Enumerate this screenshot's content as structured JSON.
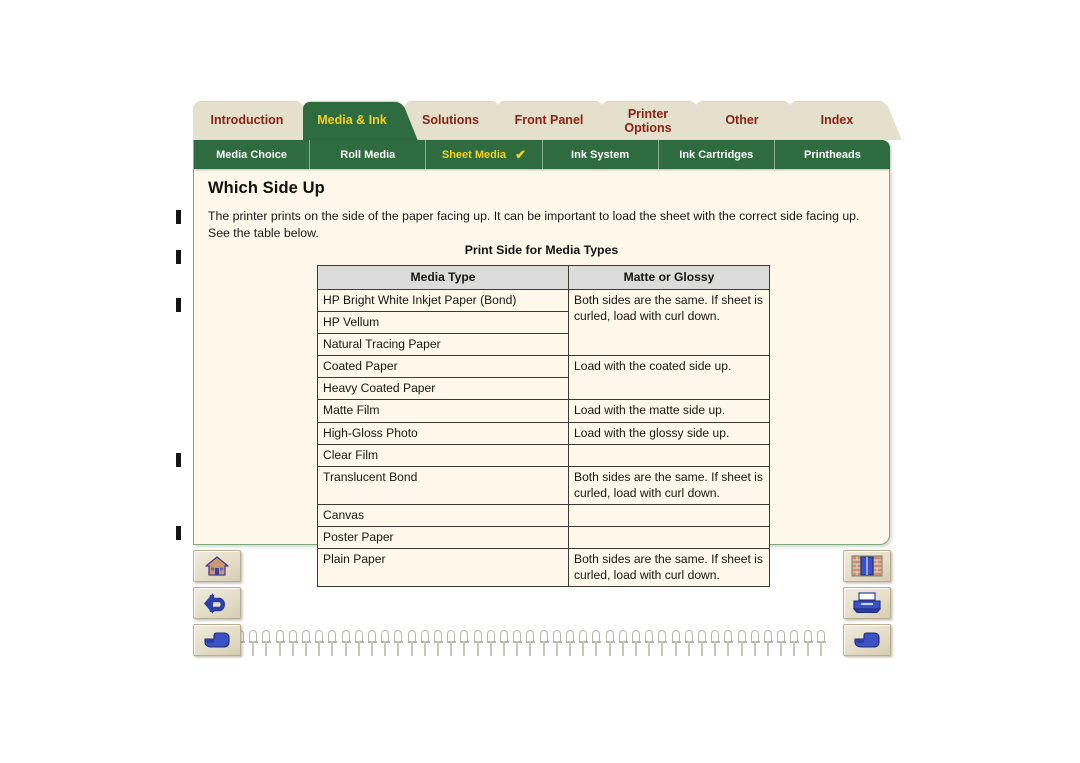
{
  "main_tabs": [
    {
      "label": "Introduction",
      "active": false
    },
    {
      "label": "Media & Ink",
      "active": true
    },
    {
      "label": "Solutions",
      "active": false
    },
    {
      "label": "Front Panel",
      "active": false
    },
    {
      "label": "Printer Options",
      "active": false,
      "line1": "Printer",
      "line2": "Options"
    },
    {
      "label": "Other",
      "active": false
    },
    {
      "label": "Index",
      "active": false
    }
  ],
  "sub_tabs": [
    {
      "label": "Media Choice",
      "active": false,
      "check": ""
    },
    {
      "label": "Roll Media",
      "active": false,
      "check": ""
    },
    {
      "label": "Sheet Media",
      "active": true,
      "check": "✔"
    },
    {
      "label": "Ink System",
      "active": false,
      "check": ""
    },
    {
      "label": "Ink Cartridges",
      "active": false,
      "check": ""
    },
    {
      "label": "Printheads",
      "active": false,
      "check": ""
    }
  ],
  "content": {
    "title": "Which Side Up",
    "intro": "The printer prints on the side of the paper facing up. It can be important to load the sheet with the correct side facing up. See the table below.",
    "table_caption": "Print Side for Media Types"
  },
  "table": {
    "headers": [
      "Media Type",
      "Matte or Glossy"
    ],
    "rows": [
      {
        "media": "HP Bright White Inkjet Paper (Bond)",
        "side": "Both sides are the same. If sheet is curled, load with curl down.",
        "side_rowspan": 3
      },
      {
        "media": "HP Vellum",
        "side": null
      },
      {
        "media": "Natural Tracing Paper",
        "side": null
      },
      {
        "media": "Coated Paper",
        "side": "Load with the coated side up.",
        "side_rowspan": 2
      },
      {
        "media": "Heavy Coated Paper",
        "side": null
      },
      {
        "media": "Matte Film",
        "side": "Load with the matte side up.",
        "side_rowspan": 1
      },
      {
        "media": "High-Gloss Photo",
        "side": "Load with the glossy side up.",
        "side_rowspan": 1
      },
      {
        "media": "Clear Film",
        "side": "",
        "side_rowspan": 1
      },
      {
        "media": "Translucent Bond",
        "side": "Both sides are the same. If sheet is curled, load with curl down.",
        "side_rowspan": 1
      },
      {
        "media": "Canvas",
        "side": "",
        "side_rowspan": 1
      },
      {
        "media": "Poster Paper",
        "side": "",
        "side_rowspan": 1
      },
      {
        "media": "Plain Paper",
        "side": "Both sides are the same. If sheet is curled, load with curl down.",
        "side_rowspan": 1
      }
    ]
  },
  "nav_buttons": {
    "left": [
      {
        "name": "home-button",
        "icon": "home-icon"
      },
      {
        "name": "back-button",
        "icon": "back-arrow-icon"
      },
      {
        "name": "next-page-button-left",
        "icon": "pointing-hand-icon"
      }
    ],
    "right": [
      {
        "name": "exit-button",
        "icon": "exit-door-icon"
      },
      {
        "name": "print-button",
        "icon": "printer-icon"
      },
      {
        "name": "next-page-button-right",
        "icon": "pointing-hand-icon"
      }
    ]
  },
  "edge_markers": {
    "count": 5,
    "positions": [
      210,
      250,
      298,
      453,
      526
    ]
  },
  "colors": {
    "green": "#2e6b3e",
    "tab_cream": "#e5e0cc",
    "tab_text": "#8b2114",
    "active_tab_text": "#f5d020",
    "page_bg": "#fdf8e9",
    "table_header_bg": "#dcdcdc"
  }
}
